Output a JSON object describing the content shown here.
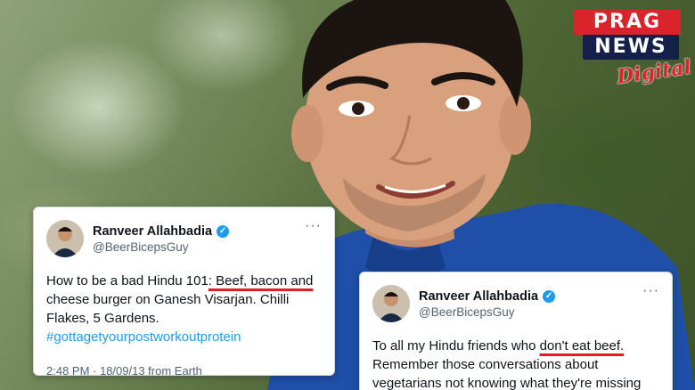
{
  "brand": {
    "logo_line1": "PRAG",
    "logo_line2": "NEWS",
    "logo_line3": "Digital",
    "colors": {
      "red": "#d8242a",
      "navy": "#14204a",
      "twitter_blue": "#1d9bf0",
      "underline_red": "#e02020"
    }
  },
  "tweets": [
    {
      "name": "Ranveer Allahbadia",
      "handle": "@BeerBicepsGuy",
      "verified_icon": "verified-badge-icon",
      "more_label": "···",
      "text_plain_1": "How to be a bad Hindu 101",
      "text_highlight": ": Beef, bacon and",
      "text_plain_2": "cheese burger on Ganesh Visarjan. Chilli Flakes, 5 Gardens.",
      "hashtag": "#gottagetyourpostworkoutprotein",
      "meta": "2:48 PM · 18/09/13 from Earth"
    },
    {
      "name": "Ranveer Allahbadia",
      "handle": "@BeerBicepsGuy",
      "verified_icon": "verified-badge-icon",
      "more_label": "···",
      "text_plain_1": "To all my Hindu friends who ",
      "text_highlight": "don't eat beef.",
      "text_plain_2": "Remember those conversations about vegetarians not knowing what they're missing"
    }
  ]
}
